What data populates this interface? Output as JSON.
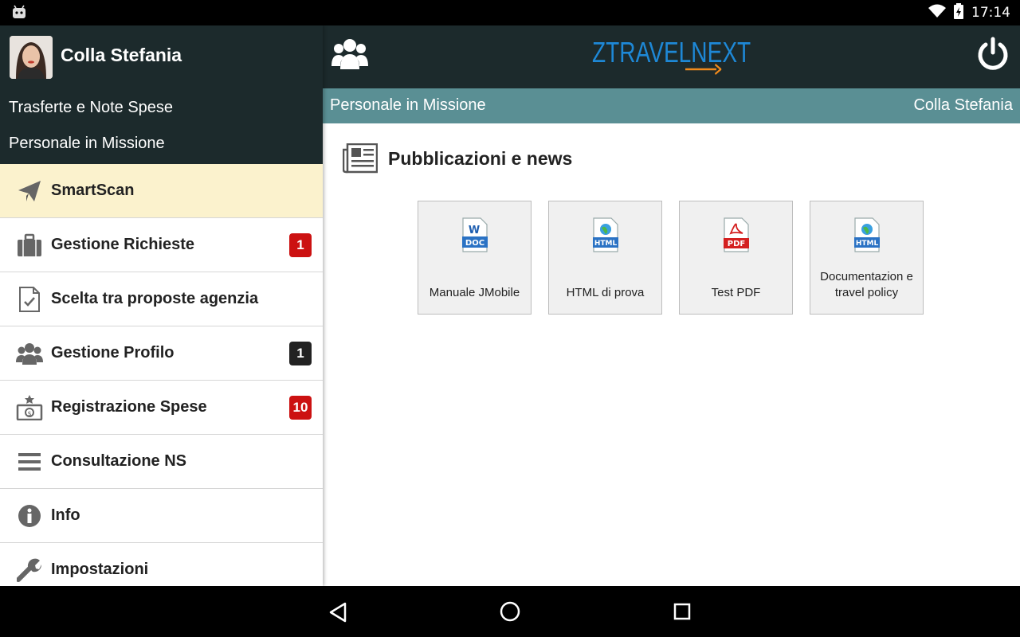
{
  "status_bar": {
    "time": "17:14"
  },
  "sidebar": {
    "user_name": "Colla Stefania",
    "header_line1": "Trasferte e Note Spese",
    "header_line2": "Personale in Missione",
    "items": [
      {
        "label": "SmartScan",
        "icon": "paper-plane-icon"
      },
      {
        "label": "Gestione Richieste",
        "icon": "briefcase-icon",
        "badge": "1"
      },
      {
        "label": "Scelta tra proposte agenzia",
        "icon": "checked-document-icon"
      },
      {
        "label": "Gestione Profilo",
        "icon": "users-icon",
        "badge": "1"
      },
      {
        "label": "Registrazione Spese",
        "icon": "money-bill-icon",
        "badge": "10"
      },
      {
        "label": "Consultazione NS",
        "icon": "list-icon"
      },
      {
        "label": "Info",
        "icon": "info-icon"
      },
      {
        "label": "Impostazioni",
        "icon": "wrench-icon"
      }
    ]
  },
  "header": {
    "logo_left": "ZTRAVEL",
    "logo_right": "NEXT",
    "sub_left": "Personale in Missione",
    "sub_right": "Colla Stefania"
  },
  "content": {
    "section_title": "Pubblicazioni e news",
    "documents": [
      {
        "label": "Manuale JMobile",
        "type": "DOC"
      },
      {
        "label": "HTML di prova",
        "type": "HTML"
      },
      {
        "label": "Test PDF",
        "type": "PDF"
      },
      {
        "label": "Documentazion e travel policy",
        "type": "HTML"
      }
    ]
  },
  "colors": {
    "header_dark": "#1c2a2c",
    "subbar_teal": "#5a8f94",
    "active_item": "#fbf2cd",
    "badge_red": "#cc1111",
    "badge_dark": "#222222",
    "logo_blue": "#1e88d6",
    "logo_orange": "#f08a1c"
  }
}
